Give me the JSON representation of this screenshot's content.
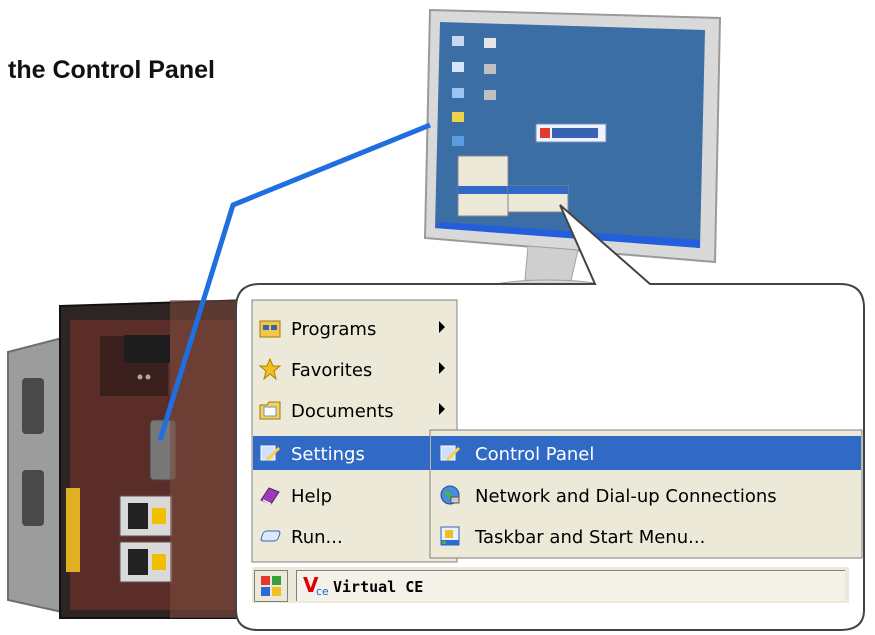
{
  "heading": "the Control Panel",
  "start_menu": {
    "items": [
      {
        "label": "Programs",
        "icon": "programs-icon",
        "has_submenu": true
      },
      {
        "label": "Favorites",
        "icon": "star-icon",
        "has_submenu": true
      },
      {
        "label": "Documents",
        "icon": "documents-icon",
        "has_submenu": true
      },
      {
        "label": "Settings",
        "icon": "settings-icon",
        "has_submenu": false,
        "highlighted": true
      },
      {
        "label": "Help",
        "icon": "help-book-icon",
        "has_submenu": false
      },
      {
        "label": "Run...",
        "icon": "run-icon",
        "has_submenu": false
      }
    ]
  },
  "settings_submenu": {
    "items": [
      {
        "label": "Control Panel",
        "icon": "control-panel-icon",
        "highlighted": true
      },
      {
        "label": "Network and Dial-up Connections",
        "icon": "network-globe-icon"
      },
      {
        "label": "Taskbar and Start Menu...",
        "icon": "taskbar-icon"
      }
    ]
  },
  "taskbar": {
    "app_logo": "V",
    "app_logo_sub": "ce",
    "app_label": "Virtual CE"
  },
  "colors": {
    "highlight": "#316ac5",
    "menu_bg": "#ece9d8",
    "cable": "#1f6fe0",
    "desktop": "#3a6ea5"
  }
}
